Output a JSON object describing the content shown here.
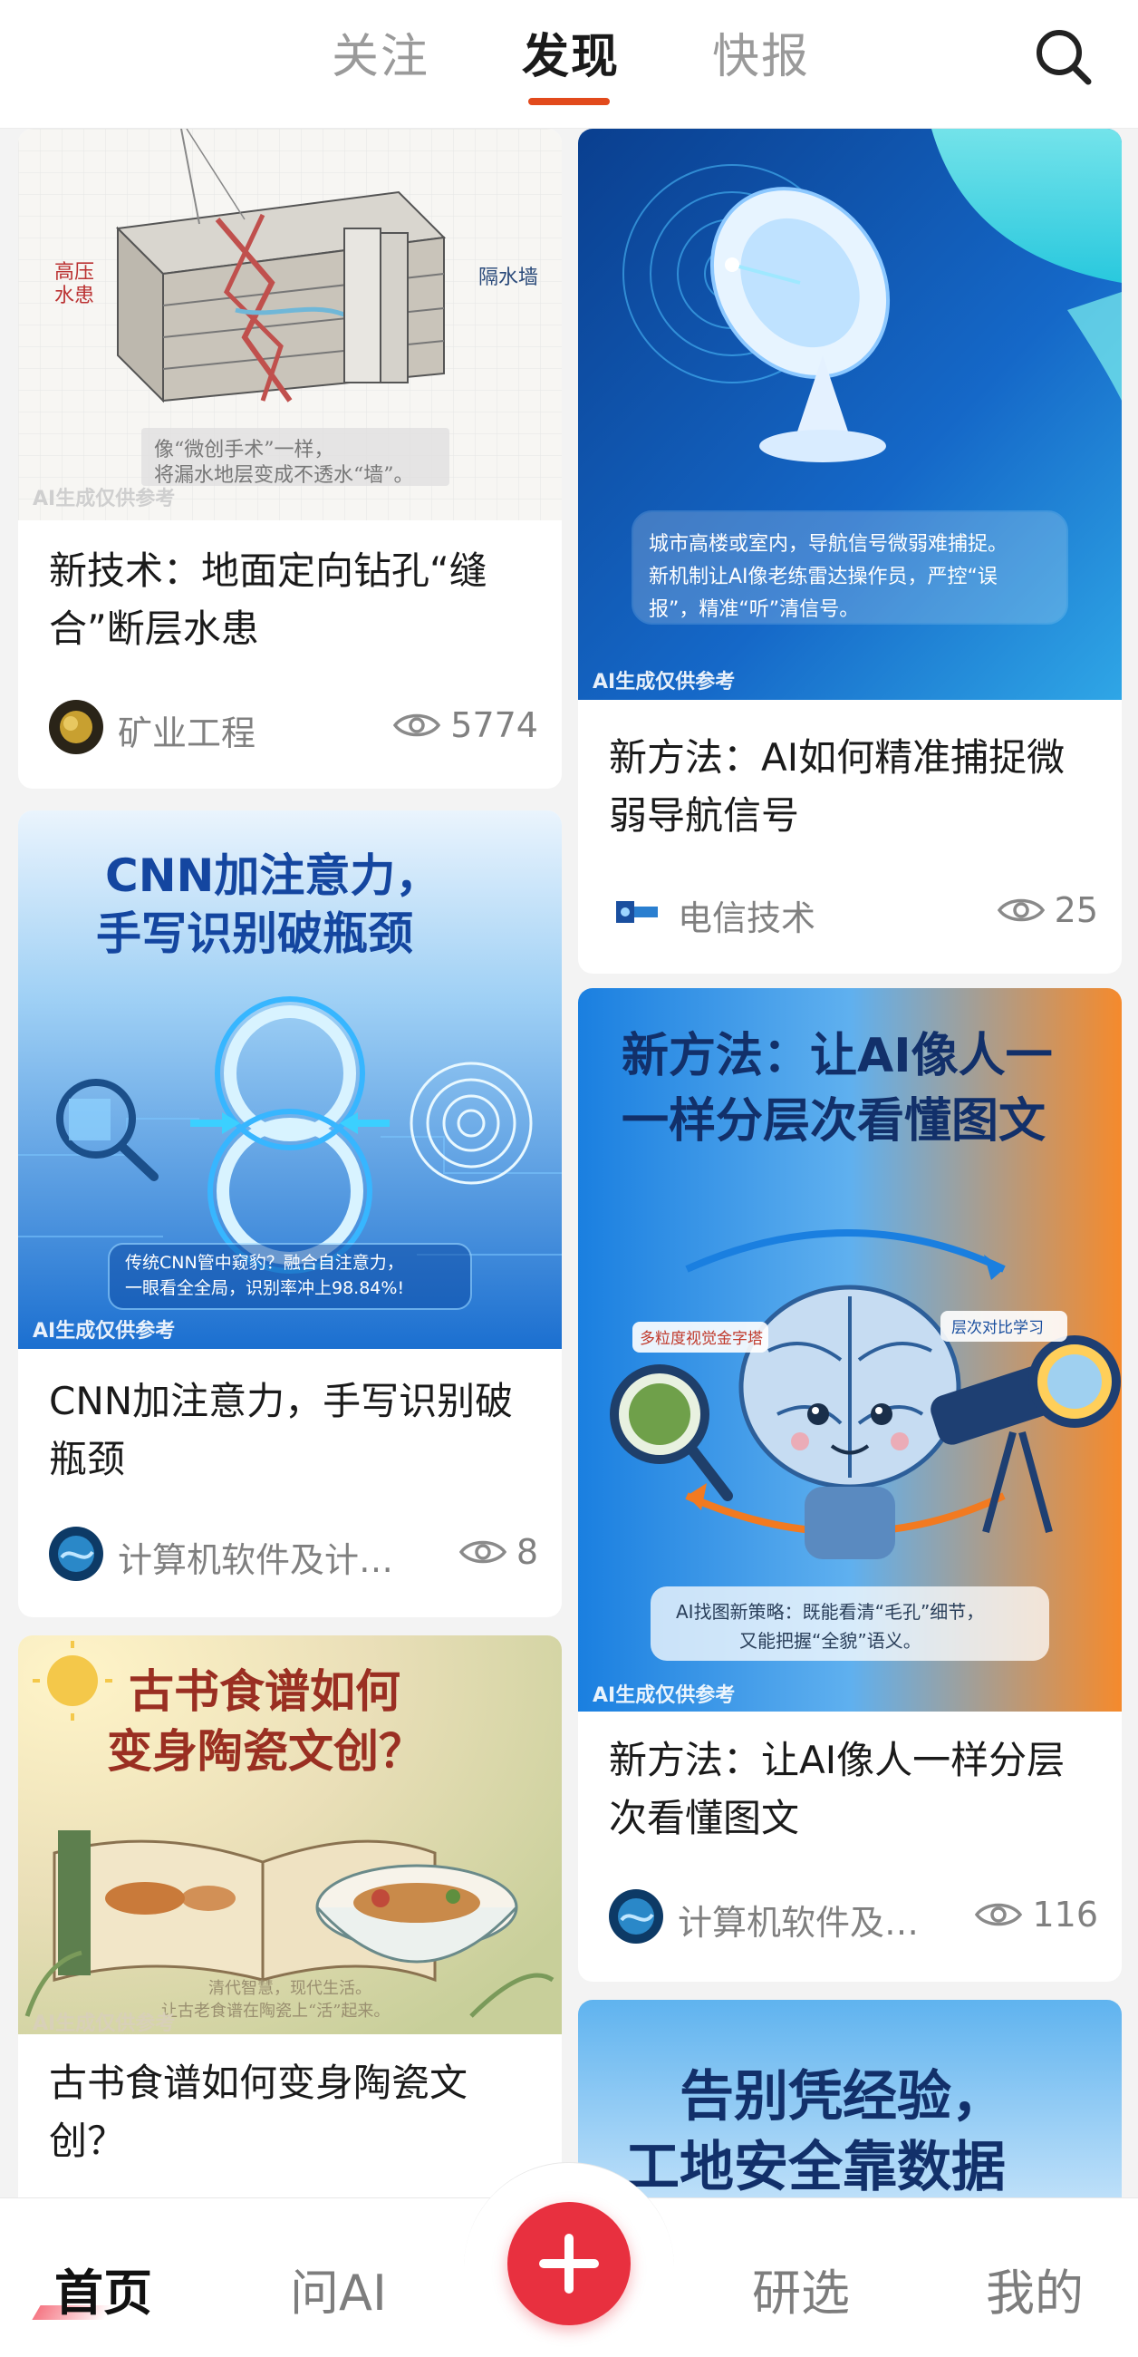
{
  "header": {
    "tabs": [
      {
        "label": "关注",
        "active": false
      },
      {
        "label": "发现",
        "active": true
      },
      {
        "label": "快报",
        "active": false
      }
    ],
    "search_icon": "search-icon",
    "accent_color": "#e24a1c"
  },
  "feed": {
    "left": [
      {
        "cover_label": "高压水患 / 隔水墙 sketch",
        "cover_text": [
          "高压",
          "水患",
          "隔水墙",
          "像“微创手术”一样，",
          "将漏水地层变成不透水“墙”。"
        ],
        "ai_mark": "AI生成仅供参考",
        "title": "新技术：地面定向钻孔“缝合”断层水患",
        "source": "矿业工程",
        "views": "5774"
      },
      {
        "cover_text": [
          "CNN加注意力，",
          "手写识别破瓶颈",
          "传统CNN管中窥豹？融合自注意力，",
          "一眼看全全局，识别率冲上98.84%!"
        ],
        "ai_mark": "AI生成仅供参考",
        "title": "CNN加注意力，手写识别破瓶颈",
        "source": "计算机软件及计…",
        "views": "8"
      },
      {
        "cover_text": [
          "古书食谱如何",
          "变身陶瓷文创？",
          "清代智慧，现代生活。",
          "让古老食谱在陶瓷上“活”起来。"
        ],
        "ai_mark": "AI生成仅供参考",
        "title": "古书食谱如何变身陶瓷文创？"
      }
    ],
    "right": [
      {
        "cover_text": [
          "城市高楼或室内，导航信号微弱难捕捉。",
          "新机制让AI像老练雷达操作员，严控“误",
          "报”，精准“听”清信号。"
        ],
        "ai_mark": "AI生成仅供参考",
        "title": "新方法：AI如何精准捕捉微弱导航信号",
        "source": "电信技术",
        "views": "25"
      },
      {
        "cover_text": [
          "新方法：让AI像人一",
          "一样分层次看懂图文",
          "多粒度视觉金字塔",
          "层次对比学习",
          "AI找图新策略：既能看清“毛孔”细节，",
          "又能把握“全貌”语义。"
        ],
        "ai_mark": "AI生成仅供参考",
        "title": "新方法：让AI像人一样分层次看懂图文",
        "source": "计算机软件及…",
        "views": "116"
      },
      {
        "cover_text": [
          "告别凭经验，",
          "工地安全靠数据"
        ]
      }
    ]
  },
  "bottom_nav": {
    "items": [
      {
        "label": "首页",
        "active": true
      },
      {
        "label": "问AI",
        "active": false
      },
      {
        "label": "研选",
        "active": false
      },
      {
        "label": "我的",
        "active": false
      }
    ],
    "plus_icon": "plus-icon",
    "plus_color": "#e8303f"
  }
}
